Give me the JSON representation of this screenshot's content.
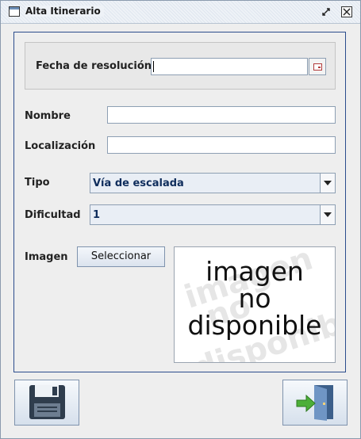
{
  "window": {
    "title": "Alta Itinerario"
  },
  "form": {
    "fecha_label": "Fecha de resolución",
    "fecha_value": "",
    "nombre_label": "Nombre",
    "nombre_value": "",
    "localizacion_label": "Localización",
    "localizacion_value": "",
    "tipo_label": "Tipo",
    "tipo_value": "Vía de escalada",
    "dificultad_label": "Dificultad",
    "dificultad_value": "1",
    "imagen_label": "Imagen",
    "seleccionar_label": "Seleccionar"
  },
  "image_placeholder": {
    "line1": "imagen",
    "line2": "no",
    "line3": "disponible"
  },
  "icons": {
    "minimize": "minimize-icon",
    "close": "close-icon",
    "calendar": "calendar-icon",
    "save": "floppy-disk-icon",
    "exit": "exit-door-icon"
  },
  "colors": {
    "panel_border": "#2b4c8c",
    "combo_text": "#0f2d5c"
  }
}
